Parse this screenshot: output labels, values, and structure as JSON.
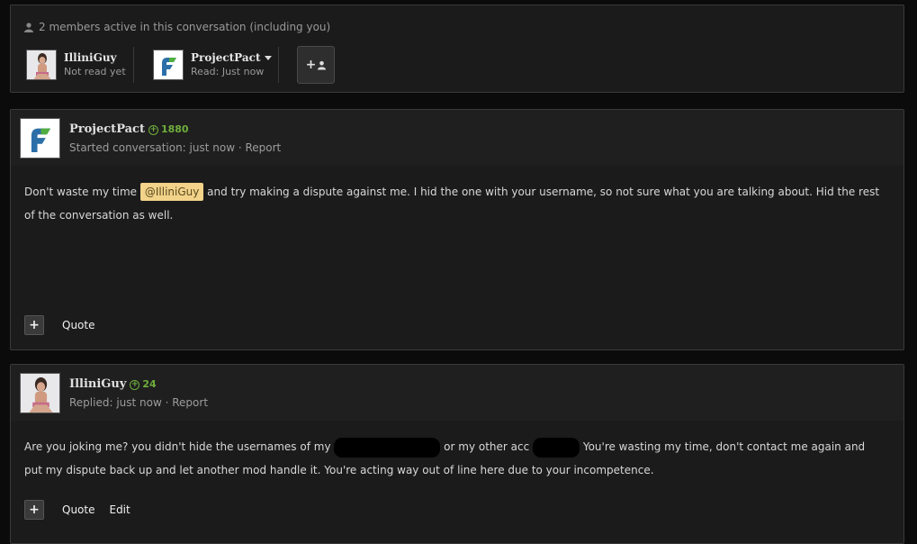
{
  "members": {
    "header": "2 members active in this conversation (including you)",
    "list": [
      {
        "name": "IlliniGuy",
        "status": "Not read yet"
      },
      {
        "name": "ProjectPact",
        "status": "Read: Just now"
      }
    ],
    "invite_icon": "add-user-icon"
  },
  "messages": [
    {
      "author": "ProjectPact",
      "reputation": "1880",
      "meta_text": "Started conversation: just now",
      "report_label": "Report",
      "body_before": "Don't waste my time ",
      "mention": "@IlliniGuy",
      "body_after": " and try making a dispute against me. I hid the one with your username, so not sure what you are talking about. Hid the rest of the conversation as well.",
      "quote_label": "Quote"
    },
    {
      "author": "IlliniGuy",
      "reputation": "24",
      "meta_text": "Replied: just now",
      "report_label": "Report",
      "body_part1": "Are you joking me? you didn't hide the usernames of my ",
      "body_part2": " or my other acc ",
      "body_part3": " You're wasting my time, don't contact me again and put my dispute back up and let another mod handle it. You're acting way out of line here due to your incompetence.",
      "quote_label": "Quote",
      "edit_label": "Edit"
    }
  ],
  "colors": {
    "reputation": "#6fae3c",
    "mention_bg": "#f2d389",
    "panel_bg": "#1b1b1b"
  }
}
